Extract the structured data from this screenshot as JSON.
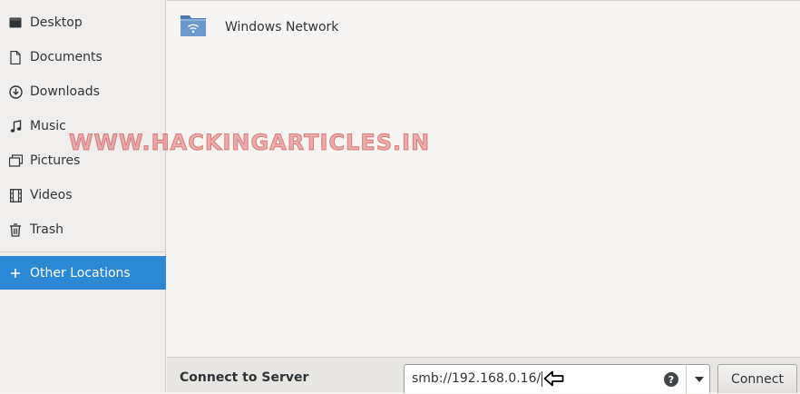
{
  "sidebar": {
    "items": [
      {
        "label": "Desktop",
        "icon": "desktop-icon"
      },
      {
        "label": "Documents",
        "icon": "document-icon"
      },
      {
        "label": "Downloads",
        "icon": "download-icon"
      },
      {
        "label": "Music",
        "icon": "music-icon"
      },
      {
        "label": "Pictures",
        "icon": "pictures-icon"
      },
      {
        "label": "Videos",
        "icon": "video-icon"
      },
      {
        "label": "Trash",
        "icon": "trash-icon"
      }
    ],
    "other_locations": {
      "label": "Other Locations",
      "icon": "plus-icon"
    }
  },
  "main": {
    "locations": [
      {
        "label": "Windows Network",
        "icon": "network-folder-icon"
      }
    ]
  },
  "watermark": "WWW.HACKINGARTICLES.IN",
  "bottom": {
    "title": "Connect to Server",
    "address_value": "smb://192.168.0.16/",
    "help_glyph": "?",
    "connect_label": "Connect"
  },
  "colors": {
    "accent": "#2a88d4",
    "sidebar_bg": "#efeeed",
    "watermark": "#e06e6e"
  }
}
